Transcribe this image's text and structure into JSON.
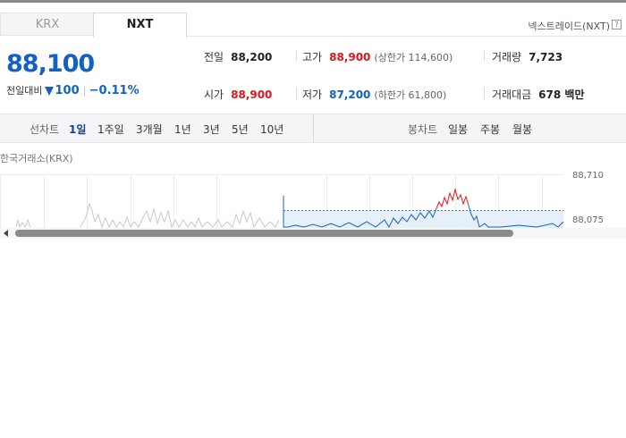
{
  "tabs": [
    {
      "label": "KRX",
      "active": false
    },
    {
      "label": "NXT",
      "active": true
    }
  ],
  "nxt_link": "넥스트레이드(NXT)",
  "price": {
    "current": "88,100",
    "change_label": "전일대비",
    "change_amount": "100",
    "change_percent": "−0.11%",
    "direction": "down"
  },
  "stats": {
    "prev_close": {
      "label": "전일",
      "value": "88,200"
    },
    "high": {
      "label": "고가",
      "value": "88,900",
      "limit": "(상한가 114,600)"
    },
    "volume": {
      "label": "거래량",
      "value": "7,723"
    },
    "open": {
      "label": "시가",
      "value": "88,900"
    },
    "low": {
      "label": "저가",
      "value": "87,200",
      "limit": "(하한가 61,800)"
    },
    "amount": {
      "label": "거래대금",
      "value": "678 백만"
    }
  },
  "toolbar": {
    "line_label": "선차트",
    "line_periods": [
      "1일",
      "1주일",
      "3개월",
      "1년",
      "3년",
      "5년",
      "10년"
    ],
    "line_active": "1일",
    "candle_label": "봉차트",
    "candle_periods": [
      "일봉",
      "주봉",
      "월봉"
    ]
  },
  "chart_title": "한국거래소(KRX)",
  "chart_data": {
    "type": "line",
    "yticks": [
      "88,710",
      "88,075"
    ],
    "reference_line": 88075,
    "colors": {
      "up": "#e0161b",
      "down": "#1261c4",
      "history": "#c8c8c8"
    }
  }
}
